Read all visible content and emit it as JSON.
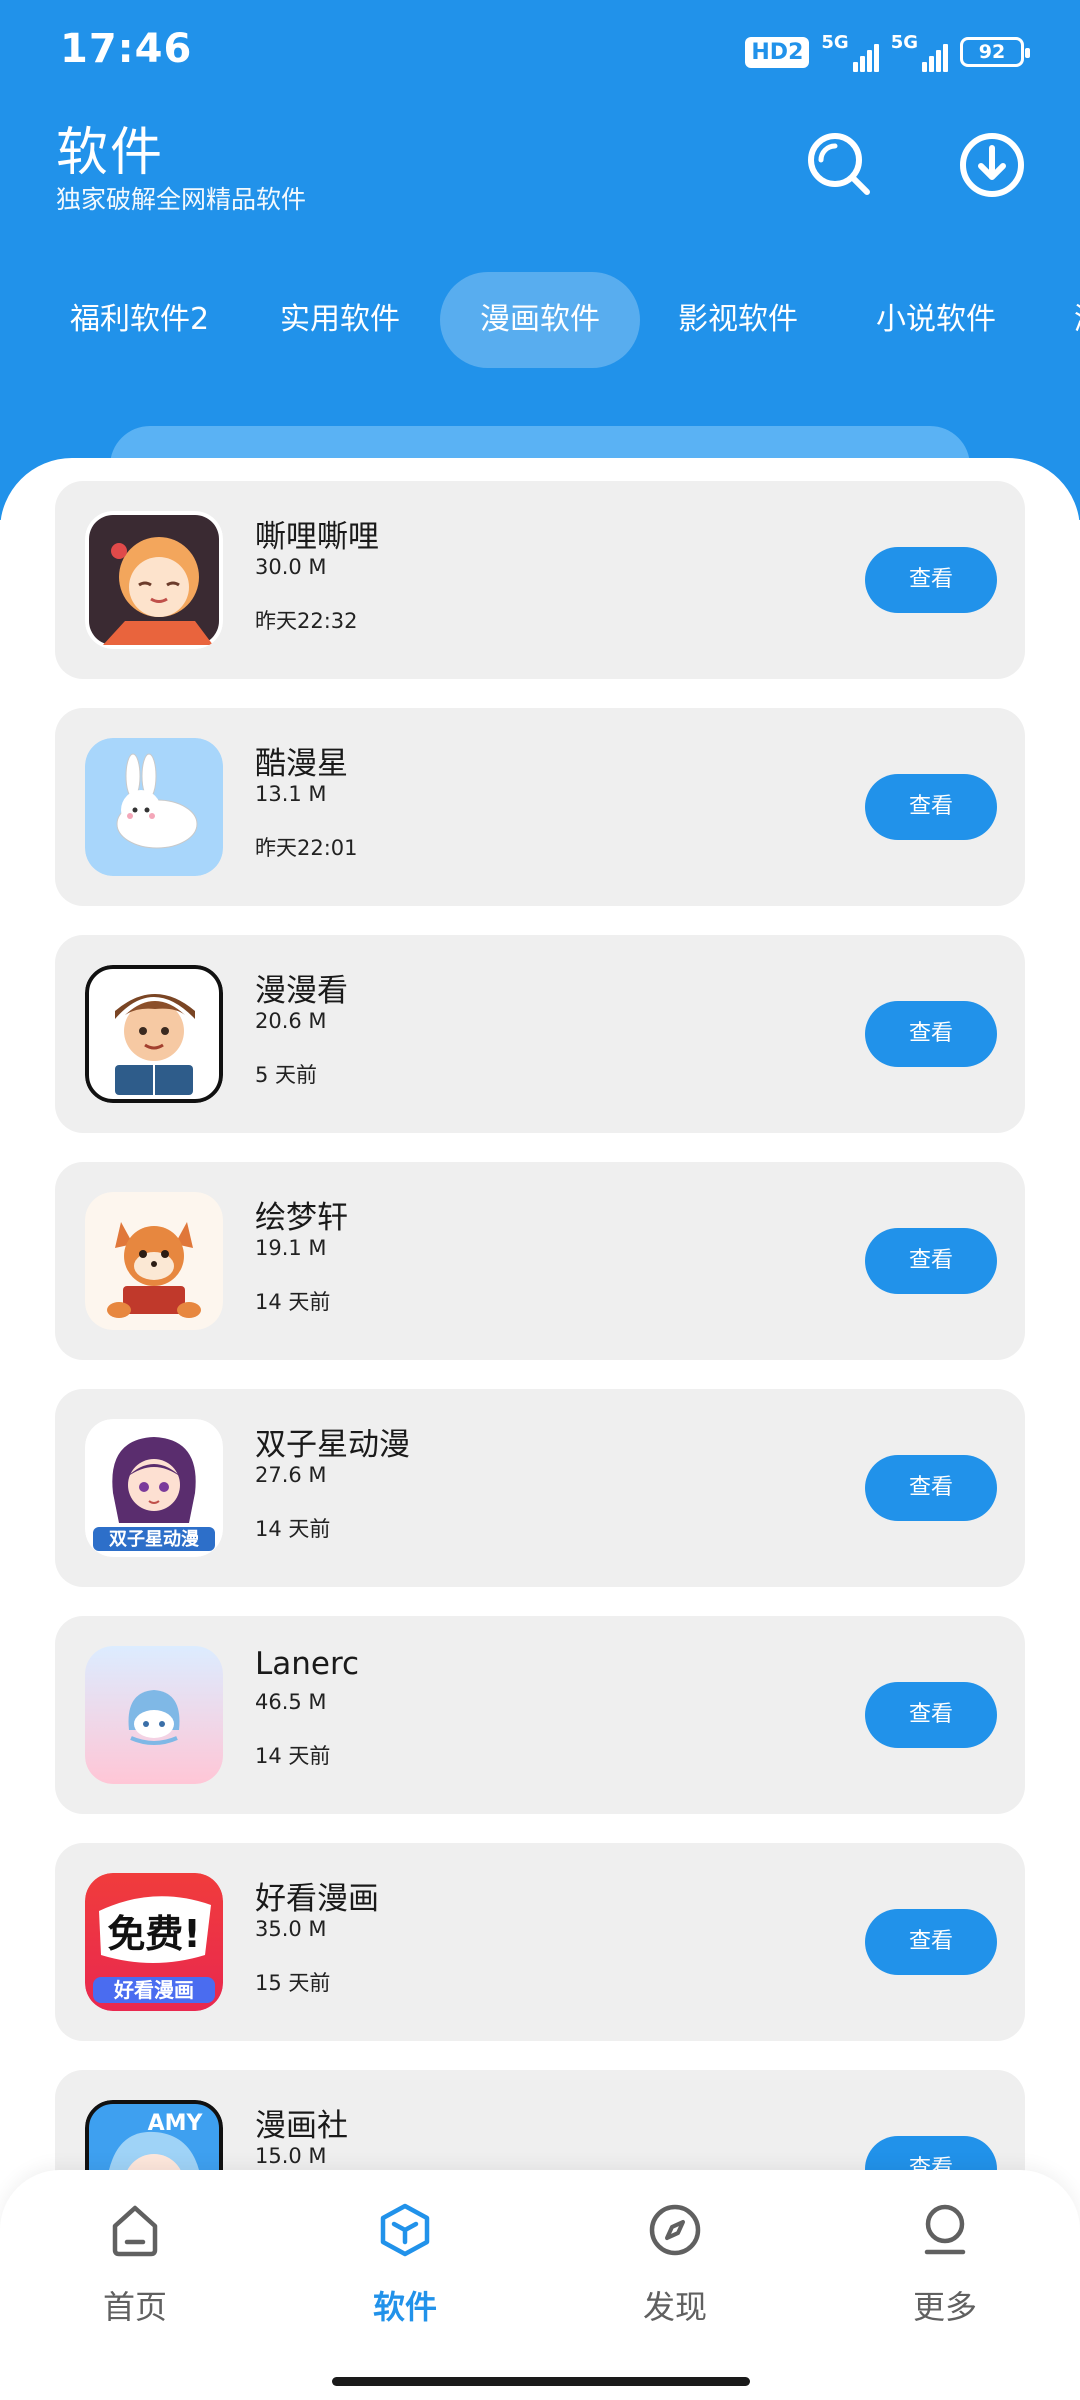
{
  "status_bar": {
    "time": "17:46",
    "hd_badge": "HD2",
    "network_1": "5G",
    "network_2": "5G",
    "battery": "92"
  },
  "header": {
    "title": "软件",
    "subtitle": "独家破解全网精品软件",
    "search_icon": "search-icon",
    "download_icon": "download-icon"
  },
  "tabs": [
    {
      "label": "福利软件2",
      "active": false
    },
    {
      "label": "实用软件",
      "active": false
    },
    {
      "label": "漫画软件",
      "active": true
    },
    {
      "label": "影视软件",
      "active": false
    },
    {
      "label": "小说软件",
      "active": false
    },
    {
      "label": "游",
      "active": false
    }
  ],
  "apps": [
    {
      "name": "嘶哩嘶哩",
      "size": "30.0 M",
      "time": "昨天22:32",
      "button": "查看"
    },
    {
      "name": "酷漫星",
      "size": "13.1 M",
      "time": "昨天22:01",
      "button": "查看"
    },
    {
      "name": "漫漫看",
      "size": "20.6 M",
      "time": "5 天前",
      "button": "查看"
    },
    {
      "name": "绘梦轩",
      "size": "19.1 M",
      "time": "14 天前",
      "button": "查看"
    },
    {
      "name": "双子星动漫",
      "size": "27.6 M",
      "time": "14 天前",
      "button": "查看",
      "icon_text": "双子星动漫"
    },
    {
      "name": "Lanerc",
      "size": "46.5 M",
      "time": "14 天前",
      "button": "查看"
    },
    {
      "name": "好看漫画",
      "size": "35.0 M",
      "time": "15 天前",
      "button": "查看",
      "icon_text": "免费!",
      "icon_text_2": "好看漫画"
    },
    {
      "name": "漫画社",
      "size": "15.0 M",
      "time": "",
      "button": "查看",
      "icon_text": "AMY"
    }
  ],
  "bottom_nav": [
    {
      "label": "首页",
      "icon": "home-icon",
      "active": false
    },
    {
      "label": "软件",
      "icon": "box-icon",
      "active": true
    },
    {
      "label": "发现",
      "icon": "compass-icon",
      "active": false
    },
    {
      "label": "更多",
      "icon": "user-icon",
      "active": false
    }
  ],
  "colors": {
    "primary": "#2192ea",
    "card_bg": "#efefef",
    "nav_inactive": "#606060"
  }
}
